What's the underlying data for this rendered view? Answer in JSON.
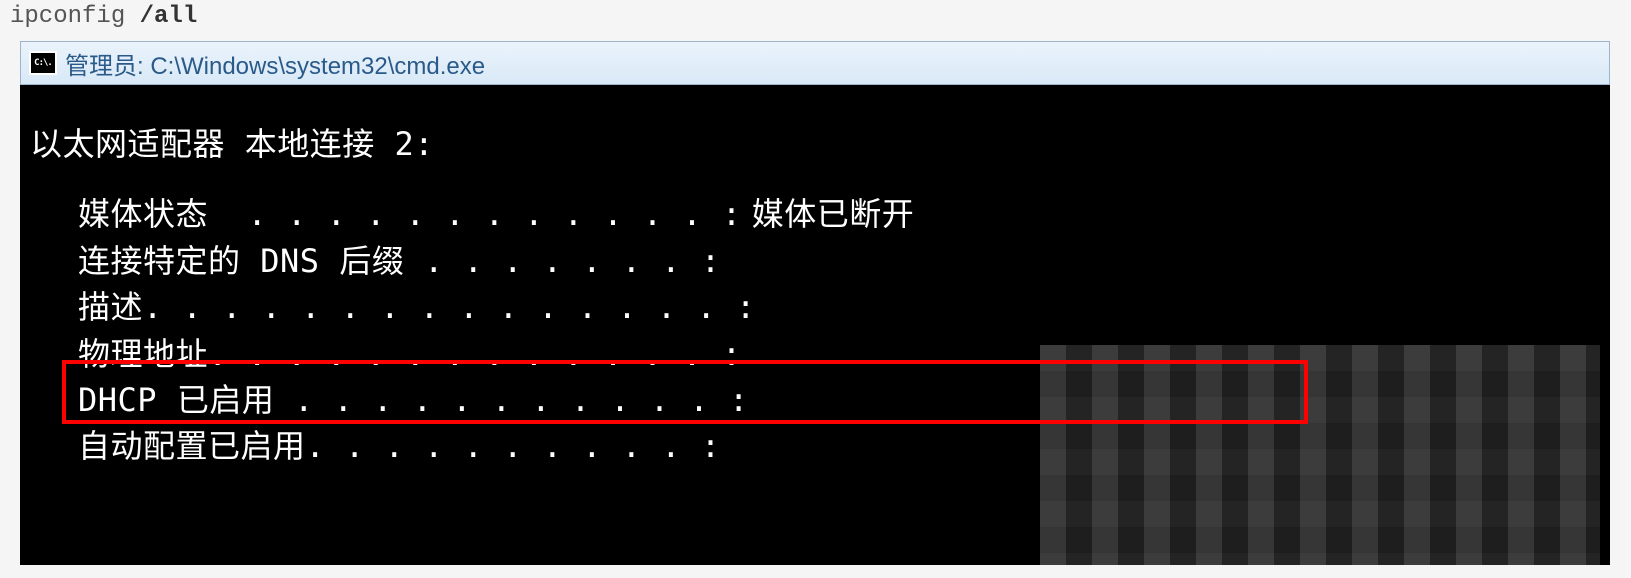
{
  "code": {
    "command": "ipconfig ",
    "flag": "/all"
  },
  "window": {
    "icon_text": "C:\\.",
    "title": "管理员: C:\\Windows\\system32\\cmd.exe"
  },
  "console": {
    "section_header": "以太网适配器 本地连接 2:",
    "rows": [
      {
        "label": "媒体状态  ",
        "dots": ". . . . . . . . . . . . :",
        "value": "媒体已断开",
        "censored": false
      },
      {
        "label": "连接特定的 DNS 后缀 ",
        "dots": ". . . . . . . :",
        "value": "",
        "censored": false
      },
      {
        "label": "描述",
        "dots": ". . . . . . . . . . . . . . . :",
        "value": "",
        "censored": true
      },
      {
        "label": "物理地址",
        "dots": ". . . . . . . . . . . . . :",
        "value": "",
        "censored": true
      },
      {
        "label": "DHCP 已启用 ",
        "dots": ". . . . . . . . . . . :",
        "value": "",
        "censored": true
      },
      {
        "label": "自动配置已启用",
        "dots": ". . . . . . . . . . :",
        "value": "",
        "censored": true
      }
    ]
  }
}
